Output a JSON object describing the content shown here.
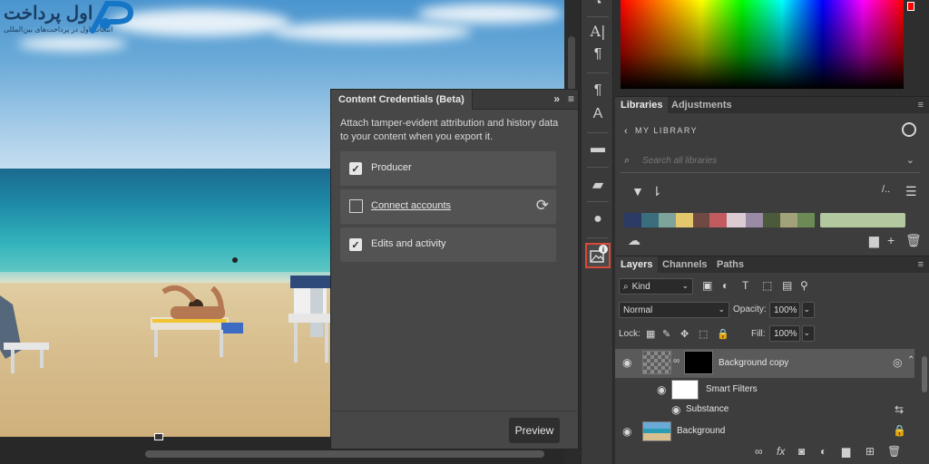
{
  "logo": {
    "main": "اول پرداخت",
    "sub": "انتخاب اول در پرداخت‌های بین‌المللی",
    "mark": "AP"
  },
  "content_credentials": {
    "title": "Content Credentials (Beta)",
    "collapse_icon": "double-chevron-right-icon",
    "description": "Attach tamper-evident attribution and history data to your content when you export it.",
    "rows": [
      {
        "label": "Producer",
        "checked": true
      },
      {
        "label": "Connect accounts",
        "type": "link"
      },
      {
        "label": "Edits and activity",
        "checked": true
      }
    ],
    "preview_label": "Preview"
  },
  "libraries": {
    "tabs": [
      "Libraries",
      "Adjustments"
    ],
    "title": "MY LIBRARY",
    "search_placeholder": "Search all libraries",
    "swatch_colors": [
      "#2c3a66",
      "#3b6e7c",
      "#7da39a",
      "#e4c66d",
      "#6e4a42",
      "#c25b60",
      "#dccbd2",
      "#9b8aa6",
      "#4b5a3a",
      "#a2a27a",
      "#6b8a55",
      "#b3c89f"
    ]
  },
  "layers": {
    "tabs": [
      "Layers",
      "Channels",
      "Paths"
    ],
    "kind_label": "Kind",
    "blend_mode": "Normal",
    "opacity_label": "Opacity:",
    "opacity_value": "100%",
    "lock_label": "Lock:",
    "fill_label": "Fill:",
    "fill_value": "100%",
    "items": [
      {
        "name": "Background copy"
      },
      {
        "name": "Smart Filters"
      },
      {
        "name": "Substance"
      },
      {
        "name": "Background"
      }
    ]
  },
  "colors": {
    "highlight": "#d94a3a",
    "panel": "#474747"
  }
}
